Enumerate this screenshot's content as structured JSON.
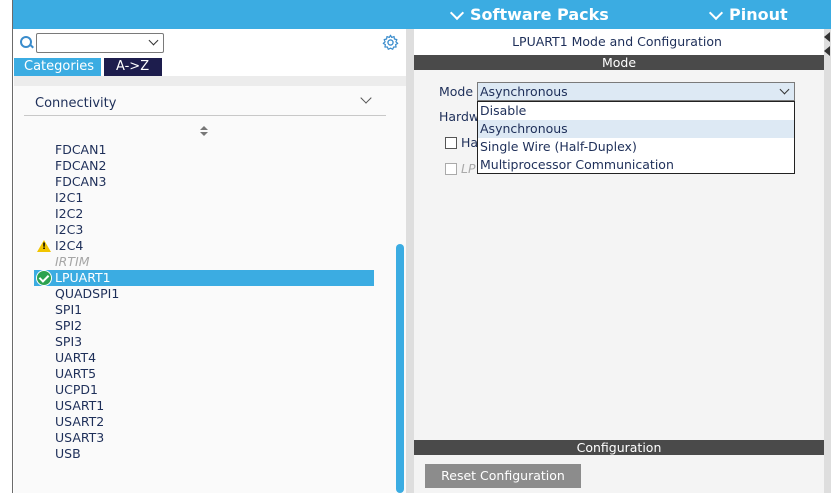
{
  "topbar": {
    "software_packs": "Software Packs",
    "pinout": "Pinout"
  },
  "left": {
    "search": {
      "value": "",
      "placeholder": ""
    },
    "tabs": [
      {
        "label": "Categories",
        "active": true
      },
      {
        "label": "A->Z",
        "active": false
      }
    ],
    "category": "Connectivity",
    "peripherals": [
      {
        "label": "FDCAN1",
        "state": "normal"
      },
      {
        "label": "FDCAN2",
        "state": "normal"
      },
      {
        "label": "FDCAN3",
        "state": "normal"
      },
      {
        "label": "I2C1",
        "state": "normal"
      },
      {
        "label": "I2C2",
        "state": "normal"
      },
      {
        "label": "I2C3",
        "state": "normal"
      },
      {
        "label": "I2C4",
        "state": "warning"
      },
      {
        "label": "IRTIM",
        "state": "disabled"
      },
      {
        "label": "LPUART1",
        "state": "selected"
      },
      {
        "label": "QUADSPI1",
        "state": "normal"
      },
      {
        "label": "SPI1",
        "state": "normal"
      },
      {
        "label": "SPI2",
        "state": "normal"
      },
      {
        "label": "SPI3",
        "state": "normal"
      },
      {
        "label": "UART4",
        "state": "normal"
      },
      {
        "label": "UART5",
        "state": "normal"
      },
      {
        "label": "UCPD1",
        "state": "normal"
      },
      {
        "label": "USART1",
        "state": "normal"
      },
      {
        "label": "USART2",
        "state": "normal"
      },
      {
        "label": "USART3",
        "state": "normal"
      },
      {
        "label": "USB",
        "state": "normal"
      }
    ]
  },
  "right": {
    "title": "LPUART1 Mode and Configuration",
    "mode_section": "Mode",
    "mode_label": "Mode",
    "mode_value": "Asynchronous",
    "hw_label_partial": "Hardw",
    "checkbox1_partial": "Ha",
    "checkbox2_partial": "LP",
    "dropdown_options": [
      "Disable",
      "Asynchronous",
      "Single Wire (Half-Duplex)",
      "Multiprocessor Communication"
    ],
    "dropdown_highlight_index": 1,
    "config_section": "Configuration",
    "reset_button": "Reset Configuration"
  },
  "colors": {
    "accent": "#3bace2",
    "dark_tab": "#1d1d4d",
    "section_bar": "#4a4a4a",
    "warning": "#f2c500",
    "ok": "#2ca24f"
  }
}
